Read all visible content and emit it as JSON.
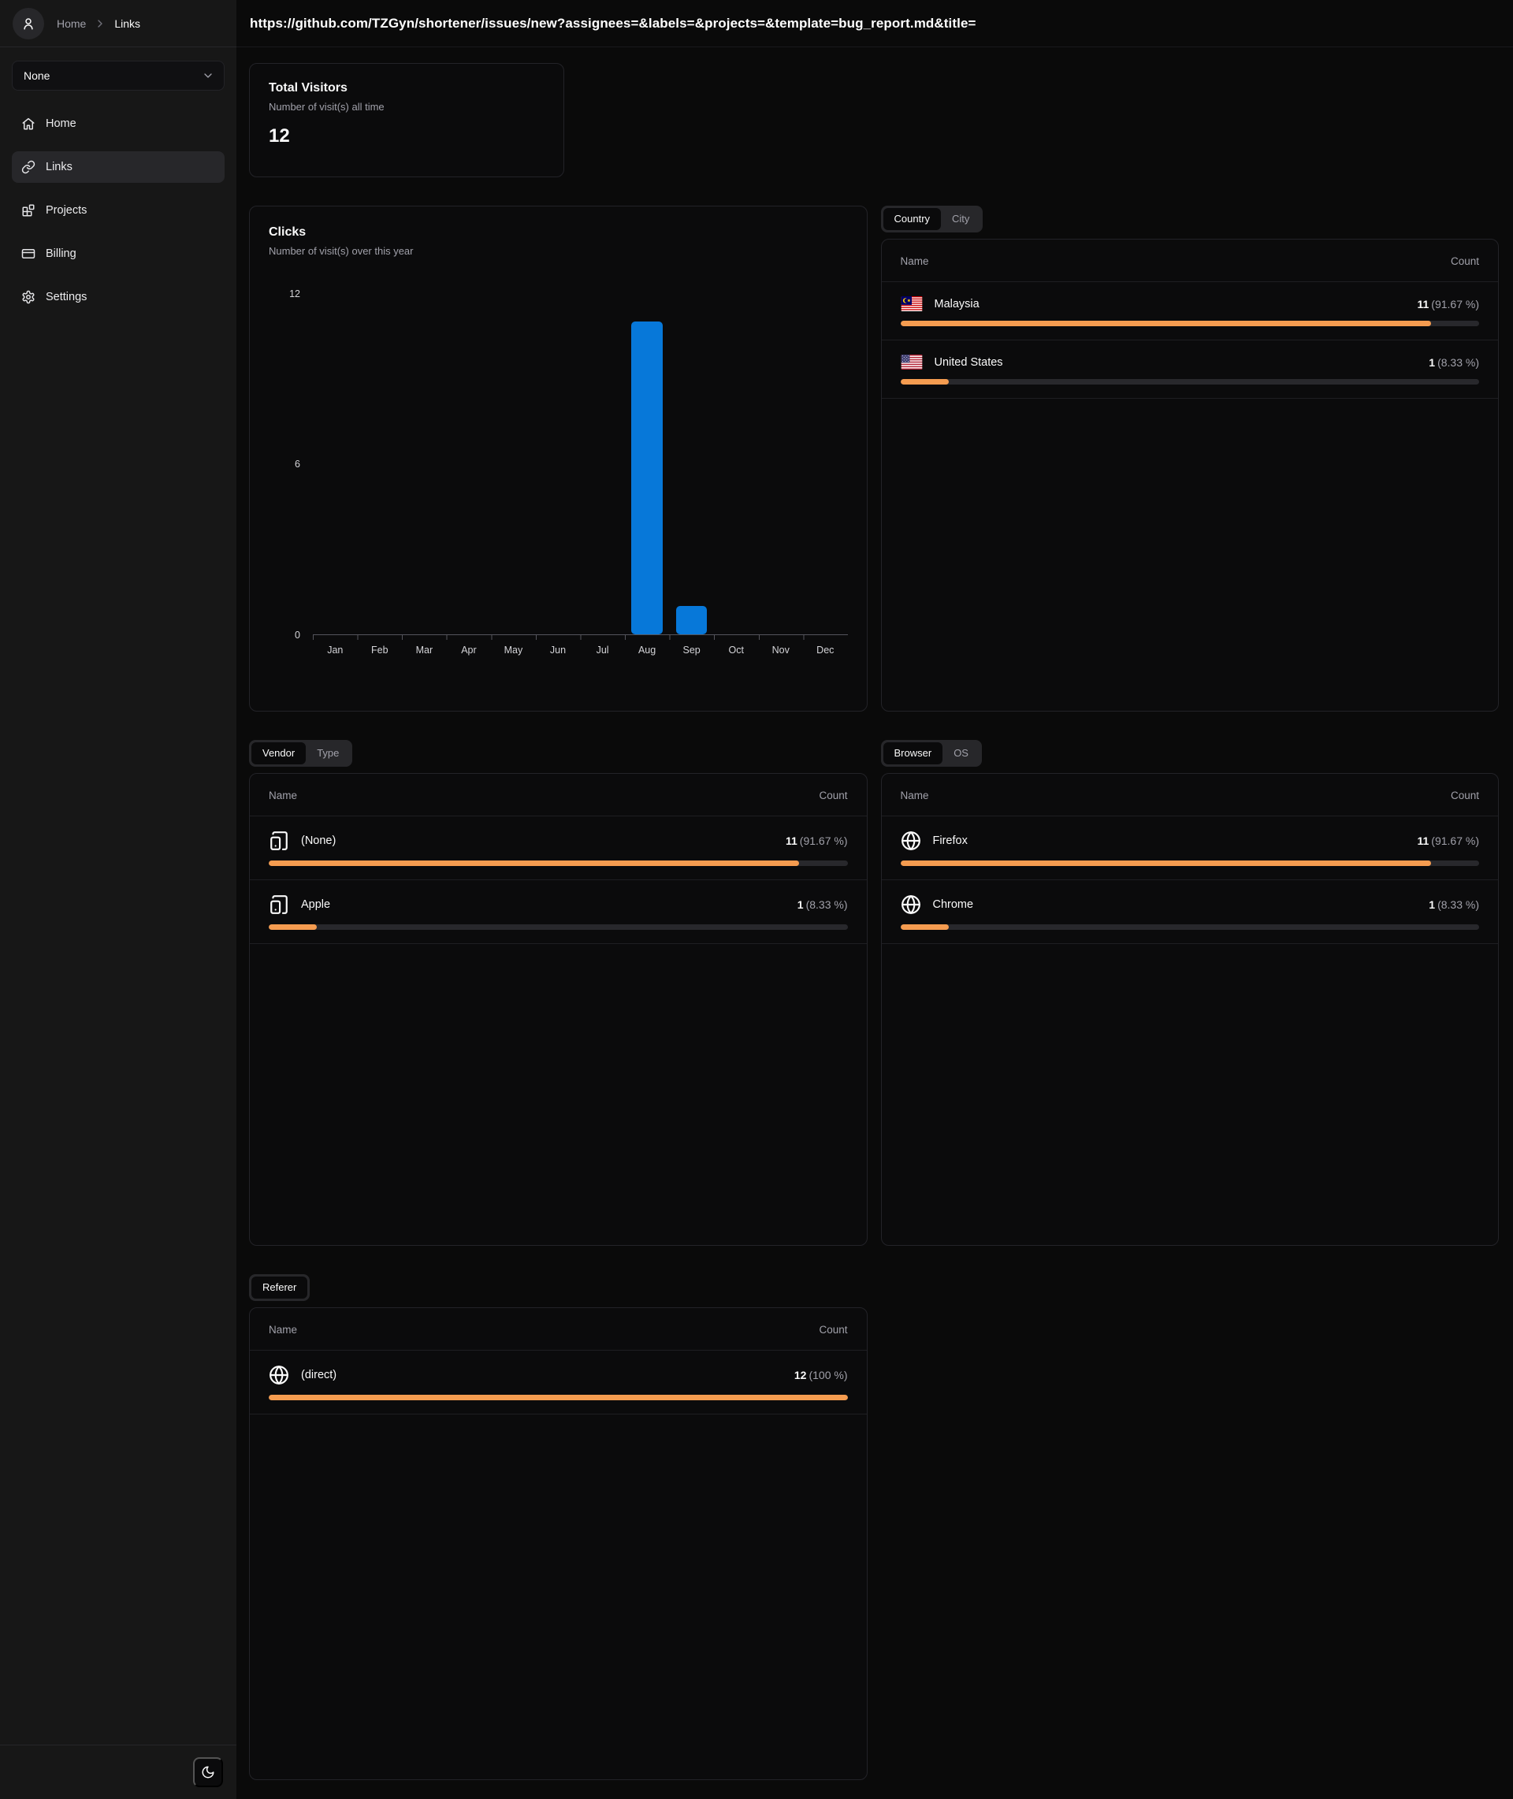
{
  "header": {
    "url": "https://github.com/TZGyn/shortener/issues/new?assignees=&labels=&projects=&template=bug_report.md&title="
  },
  "breadcrumb": {
    "home": "Home",
    "current": "Links"
  },
  "sidebar": {
    "project_select": {
      "value": "None"
    },
    "nav": [
      {
        "label": "Home"
      },
      {
        "label": "Links"
      },
      {
        "label": "Projects"
      },
      {
        "label": "Billing"
      },
      {
        "label": "Settings"
      }
    ]
  },
  "stats": {
    "title": "Total Visitors",
    "subtitle": "Number of visit(s) all time",
    "value": "12"
  },
  "chart_data": {
    "type": "bar",
    "title": "Clicks",
    "subtitle": "Number of visit(s) over this year",
    "categories": [
      "Jan",
      "Feb",
      "Mar",
      "Apr",
      "May",
      "Jun",
      "Jul",
      "Aug",
      "Sep",
      "Oct",
      "Nov",
      "Dec"
    ],
    "values": [
      0,
      0,
      0,
      0,
      0,
      0,
      0,
      11,
      1,
      0,
      0,
      0
    ],
    "ylim": [
      0,
      12
    ],
    "yticks": [
      12,
      6,
      0
    ],
    "xlabel": "",
    "ylabel": "",
    "grid": false,
    "legend": false,
    "bar_color": "#0778d9"
  },
  "panels": {
    "country": {
      "tabs": [
        {
          "label": "Country"
        },
        {
          "label": "City"
        }
      ],
      "columns": {
        "name": "Name",
        "count": "Count"
      },
      "rows": [
        {
          "name": "Malaysia",
          "count": "11",
          "percent": "(91.67 %)",
          "bar_pct": 91.67
        },
        {
          "name": "United States",
          "count": "1",
          "percent": "(8.33 %)",
          "bar_pct": 8.33
        }
      ]
    },
    "vendor": {
      "tabs": [
        {
          "label": "Vendor"
        },
        {
          "label": "Type"
        }
      ],
      "columns": {
        "name": "Name",
        "count": "Count"
      },
      "rows": [
        {
          "name": "(None)",
          "count": "11",
          "percent": "(91.67 %)",
          "bar_pct": 91.67
        },
        {
          "name": "Apple",
          "count": "1",
          "percent": "(8.33 %)",
          "bar_pct": 8.33
        }
      ]
    },
    "browser": {
      "tabs": [
        {
          "label": "Browser"
        },
        {
          "label": "OS"
        }
      ],
      "columns": {
        "name": "Name",
        "count": "Count"
      },
      "rows": [
        {
          "name": "Firefox",
          "count": "11",
          "percent": "(91.67 %)",
          "bar_pct": 91.67
        },
        {
          "name": "Chrome",
          "count": "1",
          "percent": "(8.33 %)",
          "bar_pct": 8.33
        }
      ]
    },
    "referer": {
      "tabs": [
        {
          "label": "Referer"
        }
      ],
      "columns": {
        "name": "Name",
        "count": "Count"
      },
      "rows": [
        {
          "name": "(direct)",
          "count": "12",
          "percent": "(100 %)",
          "bar_pct": 100
        }
      ]
    }
  },
  "colors": {
    "bar_blue": "#0778d9",
    "bar_orange": "#f59c50",
    "sidebar_bg": "#171717",
    "page_bg": "#0a0a0a"
  }
}
